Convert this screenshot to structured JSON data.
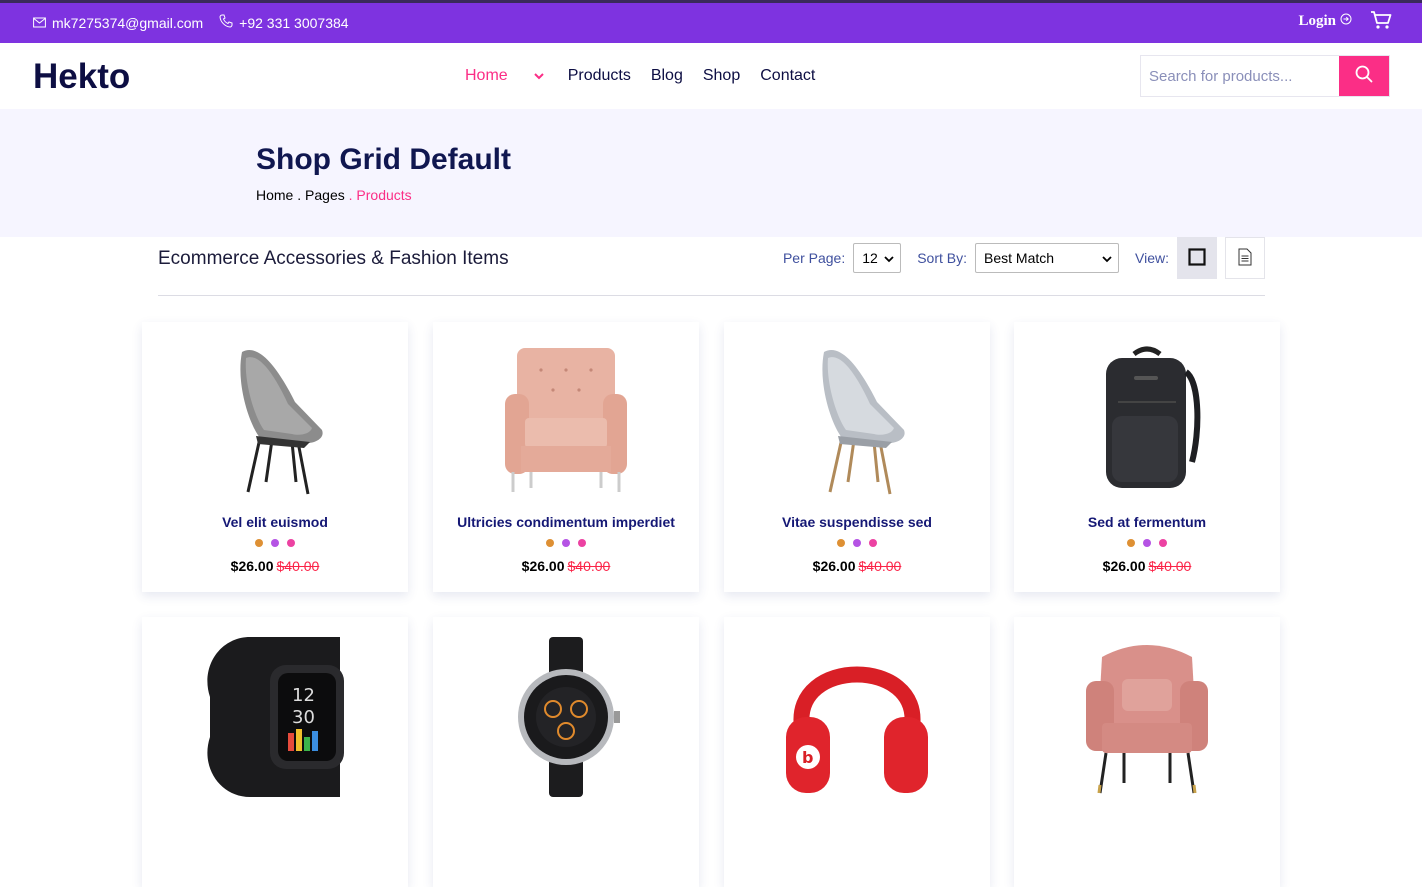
{
  "topbar": {
    "email": "mk7275374@gmail.com",
    "phone": "+92 331 3007384",
    "login_label": "Login",
    "bg_color": "#7E33E0"
  },
  "header": {
    "logo": "Hekto",
    "nav": {
      "home": "Home",
      "products": "Products",
      "blog": "Blog",
      "shop": "Shop",
      "contact": "Contact"
    },
    "search_placeholder": "Search for products...",
    "accent_color": "#FB2E86"
  },
  "banner": {
    "title": "Shop Grid Default",
    "breadcrumb": {
      "home": "Home",
      "sep1": " . ",
      "pages": "Pages",
      "sep2": " . ",
      "current": "Products"
    }
  },
  "toolbar": {
    "heading": "Ecommerce Accessories & Fashion Items",
    "per_page_label": "Per Page:",
    "per_page_value": "12",
    "sort_label": "Sort By:",
    "sort_value": "Best Match",
    "view_label": "View:"
  },
  "products": [
    {
      "name": "Vel elit euismod",
      "price": "$26.00",
      "old_price": "$40.00",
      "image": "grey-lounge-chair"
    },
    {
      "name": "Ultricies condimentum imperdiet",
      "price": "$26.00",
      "old_price": "$40.00",
      "image": "pink-armchair"
    },
    {
      "name": "Vitae suspendisse sed",
      "price": "$26.00",
      "old_price": "$40.00",
      "image": "light-lounge-chair"
    },
    {
      "name": "Sed at fermentum",
      "price": "$26.00",
      "old_price": "$40.00",
      "image": "black-backpack"
    },
    {
      "name": "",
      "price": "",
      "old_price": "",
      "image": "smartwatch"
    },
    {
      "name": "",
      "price": "",
      "old_price": "",
      "image": "round-watch"
    },
    {
      "name": "",
      "price": "",
      "old_price": "",
      "image": "red-headphones"
    },
    {
      "name": "",
      "price": "",
      "old_price": "",
      "image": "pink-wingback-chair"
    }
  ],
  "swatch_colors": [
    "#DE9034",
    "#B553E4",
    "#EC42A2"
  ]
}
